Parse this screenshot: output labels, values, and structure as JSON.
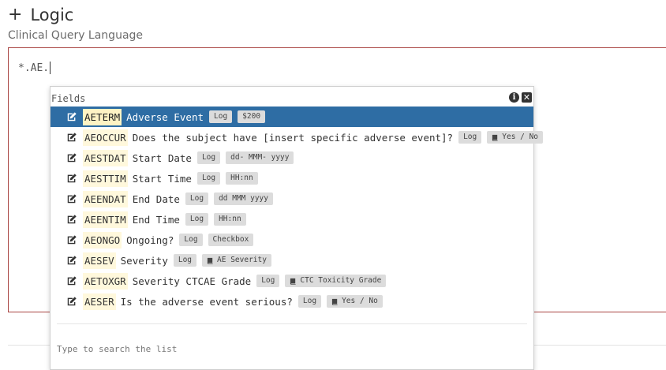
{
  "header": {
    "title": "Logic",
    "subtitle": "Clinical Query Language"
  },
  "editor": {
    "query_text": "*.AE."
  },
  "popup": {
    "title": "Fields",
    "search_placeholder": "Type to search the list",
    "fields": [
      {
        "code": "AETERM",
        "label": "Adverse Event",
        "tags": [
          {
            "text": "Log",
            "icon": false
          },
          {
            "text": "$200",
            "icon": false
          }
        ],
        "selected": true
      },
      {
        "code": "AEOCCUR",
        "label": "Does the subject have [insert specific adverse event]?",
        "tags": [
          {
            "text": "Log",
            "icon": false
          },
          {
            "text": "Yes / No",
            "icon": true
          }
        ],
        "selected": false
      },
      {
        "code": "AESTDAT",
        "label": "Start Date",
        "tags": [
          {
            "text": "Log",
            "icon": false
          },
          {
            "text": "dd- MMM- yyyy",
            "icon": false
          }
        ],
        "selected": false
      },
      {
        "code": "AESTTIM",
        "label": "Start Time",
        "tags": [
          {
            "text": "Log",
            "icon": false
          },
          {
            "text": "HH:nn",
            "icon": false
          }
        ],
        "selected": false
      },
      {
        "code": "AEENDAT",
        "label": "End Date",
        "tags": [
          {
            "text": "Log",
            "icon": false
          },
          {
            "text": "dd MMM yyyy",
            "icon": false
          }
        ],
        "selected": false
      },
      {
        "code": "AEENTIM",
        "label": "End Time",
        "tags": [
          {
            "text": "Log",
            "icon": false
          },
          {
            "text": "HH:nn",
            "icon": false
          }
        ],
        "selected": false
      },
      {
        "code": "AEONGO",
        "label": "Ongoing?",
        "tags": [
          {
            "text": "Log",
            "icon": false
          },
          {
            "text": "Checkbox",
            "icon": false
          }
        ],
        "selected": false
      },
      {
        "code": "AESEV",
        "label": "Severity",
        "tags": [
          {
            "text": "Log",
            "icon": false
          },
          {
            "text": "AE Severity",
            "icon": true
          }
        ],
        "selected": false
      },
      {
        "code": "AETOXGR",
        "label": "Severity CTCAE Grade",
        "tags": [
          {
            "text": "Log",
            "icon": false
          },
          {
            "text": "CTC Toxicity Grade",
            "icon": true
          }
        ],
        "selected": false
      },
      {
        "code": "AESER",
        "label": "Is the adverse event serious?",
        "tags": [
          {
            "text": "Log",
            "icon": false
          },
          {
            "text": "Yes / No",
            "icon": true
          }
        ],
        "selected": false
      }
    ]
  },
  "colors": {
    "selected_row": "#2e6da4",
    "editor_border": "#a94442",
    "code_highlight": "#fff8dc",
    "tag_bg": "#dcdcdc"
  },
  "icons": {
    "header": "plus-icon",
    "row": "edit-icon",
    "codelist_tag": "book-icon",
    "info": "info-icon",
    "close": "close-icon"
  }
}
